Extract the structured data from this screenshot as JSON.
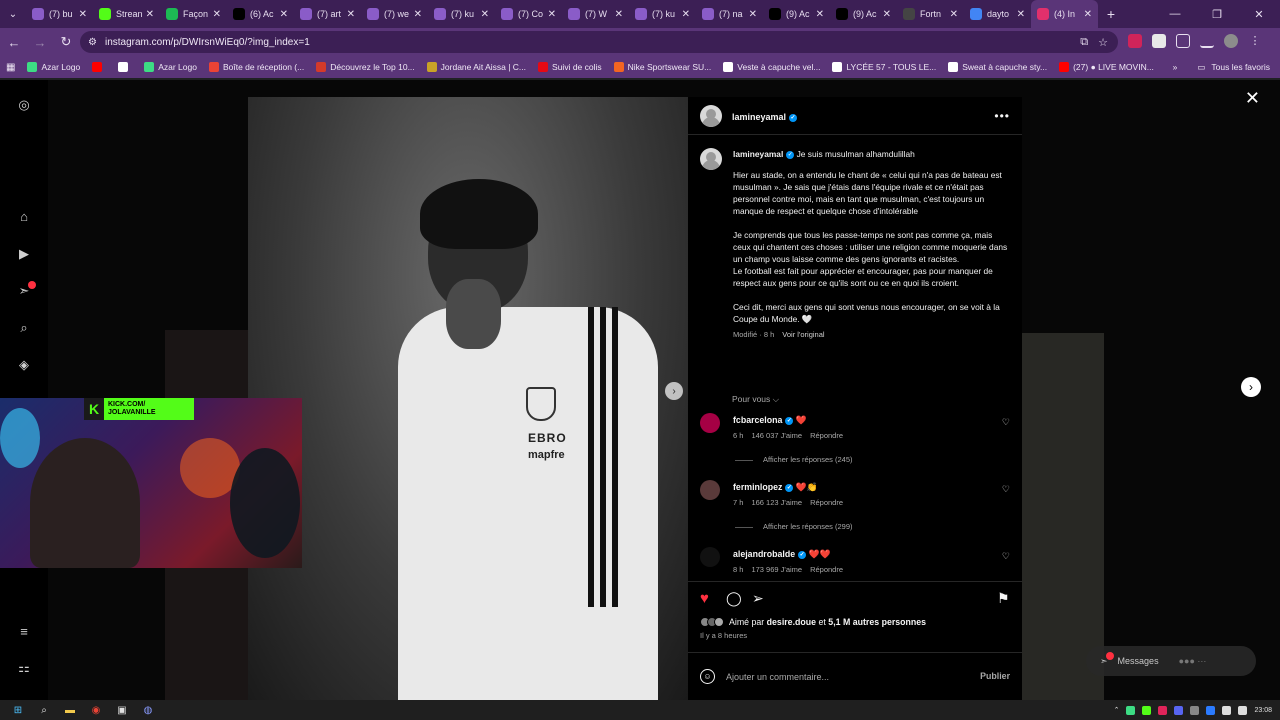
{
  "browser": {
    "tabs": [
      {
        "label": "(7) bu",
        "color": "#8a5cc8"
      },
      {
        "label": "Strean",
        "color": "#53fc18"
      },
      {
        "label": "Façon",
        "color": "#1db954"
      },
      {
        "label": "(6) Ac",
        "color": "#000000"
      },
      {
        "label": "(7) art",
        "color": "#8a5cc8"
      },
      {
        "label": "(7) we",
        "color": "#8a5cc8"
      },
      {
        "label": "(7) ku",
        "color": "#8a5cc8"
      },
      {
        "label": "(7) Co",
        "color": "#8a5cc8"
      },
      {
        "label": "(7) W",
        "color": "#8a5cc8"
      },
      {
        "label": "(7) ku",
        "color": "#8a5cc8"
      },
      {
        "label": "(7) na",
        "color": "#8a5cc8"
      },
      {
        "label": "(9) Ac",
        "color": "#000000"
      },
      {
        "label": "(9) Ac",
        "color": "#000000"
      },
      {
        "label": "Fortn",
        "color": "#444444"
      },
      {
        "label": "dayto",
        "color": "#4285f4"
      },
      {
        "label": "(4) In",
        "color": "#e1306c",
        "active": true
      }
    ],
    "url": "instagram.com/p/DWIrsnWiEq0/?img_index=1",
    "bookmarks": [
      {
        "label": "Azar Logo",
        "color": "#3ddc84"
      },
      {
        "label": "",
        "color": "#ff0000"
      },
      {
        "label": "",
        "color": "#ffffff"
      },
      {
        "label": "Azar Logo",
        "color": "#3ddc84"
      },
      {
        "label": "Boîte de réception (...",
        "color": "#ea4335"
      },
      {
        "label": "Découvrez le Top 10...",
        "color": "#d43a2a"
      },
      {
        "label": "Jordane Ait Aissa | C...",
        "color": "#c9a227"
      },
      {
        "label": "Suivi de colis",
        "color": "#e50914"
      },
      {
        "label": "Nike Sportswear SU...",
        "color": "#f26522"
      },
      {
        "label": "Veste à capuche vel...",
        "color": "#ffffff"
      },
      {
        "label": "LYCÉE 57 - TOUS LE...",
        "color": "#ffffff"
      },
      {
        "label": "Sweat à capuche sty...",
        "color": "#ffffff"
      },
      {
        "label": "(27) ● LIVE MOVIN...",
        "color": "#ff0000"
      }
    ],
    "all_bookmarks_label": "Tous les favoris"
  },
  "post": {
    "author": "lamineyamal",
    "caption_head": "Je suis musulman alhamdulillah",
    "paragraphs": [
      "Hier au stade, on a entendu le chant de « celui qui n'a pas de bateau est musulman ». Je sais que j'étais dans l'équipe rivale et ce n'était pas personnel contre moi, mais en tant que musulman, c'est toujours un manque de respect et quelque chose d'intolérable",
      "Je comprends que tous les passe-temps ne sont pas comme ça, mais ceux qui chantent ces choses : utiliser une religion comme moquerie dans un champ vous laisse comme des gens ignorants et racistes.\nLe football est fait pour apprécier et encourager, pas pour manquer de respect aux gens pour ce qu'ils sont ou ce en quoi ils croient.",
      "Ceci dit, merci aux gens qui sont venus nous encourager, on se voit à la Coupe du Monde. 🤍"
    ],
    "edited_label": "Modifié · 8 h",
    "see_original": "Voir l'original",
    "sort_label": "Pour vous",
    "jersey_sponsor": "EBRO",
    "jersey_brand": "mapfre"
  },
  "comments": [
    {
      "user": "fcbarcelona",
      "text": "❤️",
      "time": "6 h",
      "likes": "146 037 J'aime",
      "reply": "Répondre",
      "replies": "Afficher les réponses (245)",
      "avatar_color": "#a50044"
    },
    {
      "user": "ferminlopez",
      "text": "❤️👏",
      "time": "7 h",
      "likes": "166 123 J'aime",
      "reply": "Répondre",
      "replies": "Afficher les réponses (299)",
      "avatar_color": "#5a3a3a"
    },
    {
      "user": "alejandrobalde",
      "text": "❤️❤️",
      "time": "8 h",
      "likes": "173 969 J'aime",
      "reply": "Répondre",
      "replies": "",
      "avatar_color": "#111111"
    }
  ],
  "likes": {
    "prefix": "Aimé par",
    "user": "desire.doue",
    "and": "et",
    "others": "5,1 M autres personnes",
    "ago": "Il y a 8 heures"
  },
  "comment_box": {
    "placeholder": "Ajouter un commentaire...",
    "publish": "Publier"
  },
  "stream_overlay": {
    "kick_line1": "KICK.COM/",
    "kick_line2": "JOLAVANILLE"
  },
  "messages_label": "Messages",
  "clock": "23:08",
  "colors": {
    "like_red": "#ff3040",
    "verified_blue": "#0095f6",
    "browser_purple": "#5a3578"
  }
}
